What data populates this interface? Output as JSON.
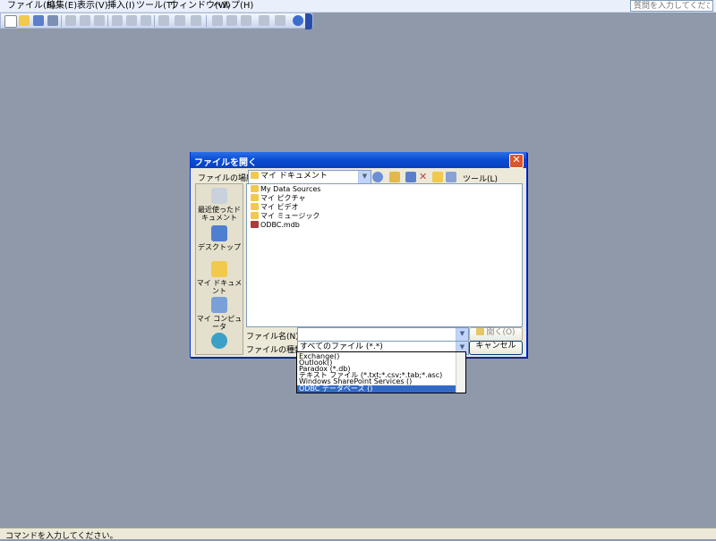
{
  "menu": [
    "ファイル(F)",
    "編集(E)",
    "表示(V)",
    "挿入(I)",
    "ツール(T)",
    "ウィンドウ(W)",
    "ヘルプ(H)"
  ],
  "help_search": {
    "placeholder": "質問を入力してください"
  },
  "dialog": {
    "title": "ファイルを開く",
    "close_glyph": "✕",
    "look_in_label": "ファイルの場所(I):",
    "look_in_value": "マイ ドキュメント",
    "tools_label": "ツール(L)",
    "places": [
      "最近使ったドキュメント",
      "デスクトップ",
      "マイ ドキュメント",
      "マイ コンピュータ"
    ],
    "files": [
      "My Data Sources",
      "マイ ピクチャ",
      "マイ ビデオ",
      "マイ ミュージック",
      "ODBC.mdb"
    ],
    "filename_label": "ファイル名(N):",
    "filename_value": "",
    "filetype_label": "ファイルの種類(T):",
    "filetype_value": "すべてのファイル (*.*)",
    "open_button": "開く(O)",
    "cancel_button": "キャンセル",
    "dropdown_options": [
      "Exchange()",
      "Outlook()",
      "Paradox (*.db)",
      "テキスト ファイル (*.txt;*.csv;*.tab;*.asc)",
      "Windows SharePoint Services ()",
      "ODBC データベース ()"
    ]
  },
  "status": {
    "text": "コマンドを入力してください。"
  }
}
